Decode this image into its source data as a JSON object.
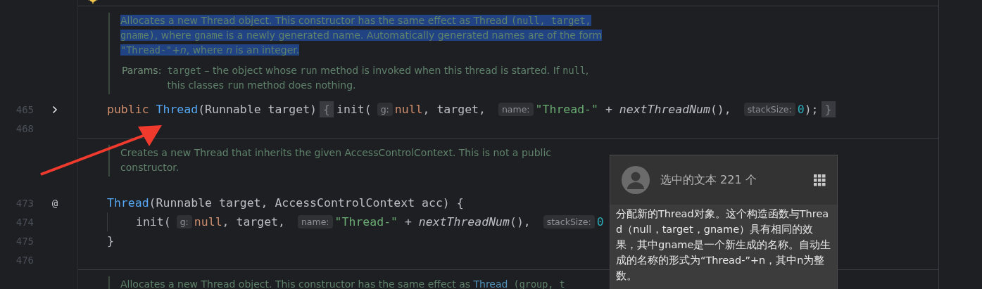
{
  "editor": {
    "blocks": [
      {
        "kind": "top"
      },
      {
        "kind": "divider"
      },
      {
        "kind": "doc",
        "paragraphs": [
          {
            "selected": true,
            "segments": [
              {
                "kind": "text",
                "text": "Allocates a new Thread object. This constructor has the same effect as Thread "
              },
              {
                "kind": "code",
                "text": "(null, target,"
              },
              {
                "kind": "break"
              },
              {
                "kind": "code",
                "text": "gname)"
              },
              {
                "kind": "text",
                "text": ", where "
              },
              {
                "kind": "code",
                "text": "gname"
              },
              {
                "kind": "text",
                "text": " is a newly generated name. Automatically generated names are of the form"
              },
              {
                "kind": "break"
              },
              {
                "kind": "code",
                "text": "\"Thread-\""
              },
              {
                "kind": "text",
                "text": "+"
              },
              {
                "kind": "italic",
                "text": "n"
              },
              {
                "kind": "text",
                "text": ", where "
              },
              {
                "kind": "italic",
                "text": "n"
              },
              {
                "kind": "text",
                "text": " is an integer."
              }
            ]
          }
        ],
        "params": {
          "label": "Params:",
          "segments": [
            {
              "kind": "code",
              "text": "target"
            },
            {
              "kind": "text",
              "text": " – the object whose "
            },
            {
              "kind": "code",
              "text": "run"
            },
            {
              "kind": "text",
              "text": " method is invoked when this thread is started. If "
            },
            {
              "kind": "code",
              "text": "null"
            },
            {
              "kind": "text",
              "text": ","
            },
            {
              "kind": "break"
            },
            {
              "kind": "text",
              "text": "this classes "
            },
            {
              "kind": "code",
              "text": "run"
            },
            {
              "kind": "text",
              "text": " method does nothing."
            }
          ]
        }
      },
      {
        "kind": "code",
        "number": "465",
        "foldable": true,
        "tokens": [
          {
            "kind": "keyword",
            "text": "public "
          },
          {
            "kind": "name",
            "text": "Thread"
          },
          {
            "kind": "plain",
            "text": "(Runnable target)"
          },
          {
            "kind": "fold",
            "text": "{"
          },
          {
            "kind": "plain",
            "text": "init("
          },
          {
            "kind": "hint",
            "text": "g:"
          },
          {
            "kind": "keyword",
            "text": "null"
          },
          {
            "kind": "plain",
            "text": ", target, "
          },
          {
            "kind": "hint",
            "text": "name:"
          },
          {
            "kind": "string",
            "text": "\"Thread-\""
          },
          {
            "kind": "plain",
            "text": " + "
          },
          {
            "kind": "call",
            "text": "nextThreadNum"
          },
          {
            "kind": "plain",
            "text": "(), "
          },
          {
            "kind": "hint",
            "text": "stackSize:"
          },
          {
            "kind": "number",
            "text": "0"
          },
          {
            "kind": "plain",
            "text": ");"
          },
          {
            "kind": "fold",
            "text": "}"
          }
        ]
      },
      {
        "kind": "code",
        "number": "468",
        "foldable": false
      },
      {
        "kind": "divider"
      },
      {
        "kind": "doc",
        "paragraphs": [
          {
            "selected": false,
            "segments": [
              {
                "kind": "text",
                "text": "Creates a new Thread that inherits the given AccessControlContext. This is not a public"
              },
              {
                "kind": "break"
              },
              {
                "kind": "text",
                "text": "constructor."
              }
            ]
          }
        ]
      },
      {
        "kind": "gap"
      },
      {
        "kind": "code",
        "number": "473",
        "foldable": false,
        "marker": "@",
        "tokens": [
          {
            "kind": "name",
            "text": "Thread"
          },
          {
            "kind": "plain",
            "text": "(Runnable target, AccessControlContext acc) {"
          }
        ]
      },
      {
        "kind": "code",
        "number": "474",
        "foldable": false,
        "tokens": [
          {
            "kind": "indent"
          },
          {
            "kind": "plain",
            "text": "init("
          },
          {
            "kind": "hint",
            "text": "g:"
          },
          {
            "kind": "keyword",
            "text": "null"
          },
          {
            "kind": "plain",
            "text": ", target, "
          },
          {
            "kind": "hint",
            "text": "name:"
          },
          {
            "kind": "string",
            "text": "\"Thread-\""
          },
          {
            "kind": "plain",
            "text": " + "
          },
          {
            "kind": "call",
            "text": "nextThreadNum"
          },
          {
            "kind": "plain",
            "text": "(), "
          },
          {
            "kind": "hint",
            "text": "stackSize:"
          },
          {
            "kind": "number",
            "text": "0"
          }
        ]
      },
      {
        "kind": "code",
        "number": "475",
        "foldable": false,
        "tokens": [
          {
            "kind": "plain",
            "text": "}"
          }
        ]
      },
      {
        "kind": "code",
        "number": "476",
        "foldable": false
      },
      {
        "kind": "divider"
      },
      {
        "kind": "doc",
        "paragraphs": [
          {
            "selected": false,
            "segments": [
              {
                "kind": "text",
                "text": "Allocates a new Thread object. This constructor has the same effect as "
              },
              {
                "kind": "link",
                "text": "Thread"
              },
              {
                "kind": "code",
                "text": " (group, t"
              }
            ]
          }
        ]
      }
    ]
  },
  "popup": {
    "title": "选中的文本 221 个",
    "body": "分配新的Thread对象。这个构造函数与Thread（null，target，gname）具有相同的效果，其中gname是一个新生成的名称。自动生成的名称的形式为“Thread-”+n，其中n为整数。"
  }
}
